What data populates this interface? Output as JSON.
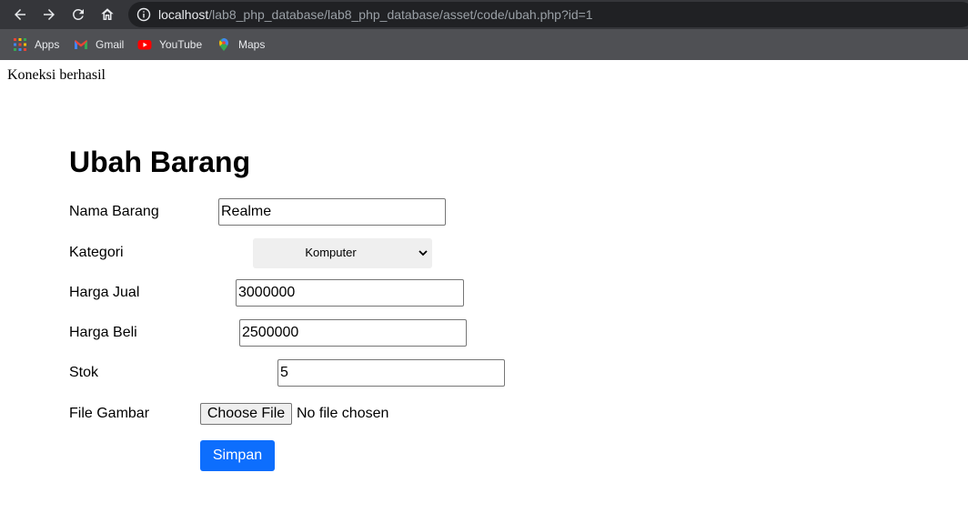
{
  "browser": {
    "url_host": "localhost",
    "url_path": "/lab8_php_database/lab8_php_database/asset/code/ubah.php?id=1",
    "nav_icons": [
      "back-icon",
      "forward-icon",
      "reload-icon",
      "home-icon",
      "info-icon"
    ],
    "bookmarks": [
      {
        "label": "Apps",
        "icon": "apps-grid-icon"
      },
      {
        "label": "Gmail",
        "icon": "gmail-icon"
      },
      {
        "label": "YouTube",
        "icon": "youtube-icon"
      },
      {
        "label": "Maps",
        "icon": "maps-icon"
      }
    ],
    "colors": {
      "toolbar": "#35363a",
      "bookmarks_bar": "#4f5054",
      "omnibox": "#202124"
    }
  },
  "page": {
    "status_text": "Koneksi berhasil",
    "title": "Ubah Barang"
  },
  "form": {
    "nama_barang": {
      "label": "Nama Barang",
      "value": "Realme"
    },
    "kategori": {
      "label": "Kategori",
      "selected": "Komputer"
    },
    "harga_jual": {
      "label": "Harga Jual",
      "value": "3000000"
    },
    "harga_beli": {
      "label": "Harga Beli",
      "value": "2500000"
    },
    "stok": {
      "label": "Stok",
      "value": "5"
    },
    "file_gambar": {
      "label": "File Gambar",
      "button_label": "Choose File",
      "status": "No file chosen"
    },
    "submit_label": "Simpan",
    "colors": {
      "submit": "#0d6efd",
      "select_bg": "#efefef"
    }
  }
}
